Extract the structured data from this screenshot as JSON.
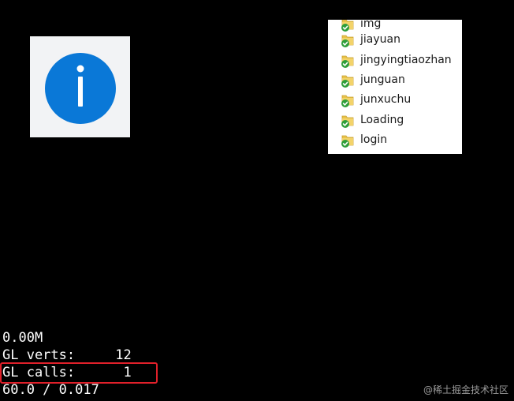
{
  "folders": [
    {
      "label": "img",
      "icon": "folder-sync-icon"
    },
    {
      "label": "jiayuan",
      "icon": "folder-sync-icon"
    },
    {
      "label": "jingyingtiaozhan",
      "icon": "folder-sync-icon"
    },
    {
      "label": "junguan",
      "icon": "folder-sync-icon"
    },
    {
      "label": "junxuchu",
      "icon": "folder-sync-icon"
    },
    {
      "label": "Loading",
      "icon": "folder-sync-icon"
    },
    {
      "label": "login",
      "icon": "folder-sync-icon"
    }
  ],
  "stats": {
    "memory": "0.00M",
    "gl_verts": "GL verts:     12",
    "gl_calls": "GL calls:      1",
    "fps": "60.0 / 0.017"
  },
  "watermark": "@稀土掘金技术社区",
  "colors": {
    "background": "#000000",
    "info_blue": "#0a78d7",
    "highlight": "#e0202a",
    "folder_yellow": "#e8c34a",
    "check_green": "#2f9e3a"
  },
  "icons": {
    "info": "info-icon"
  }
}
